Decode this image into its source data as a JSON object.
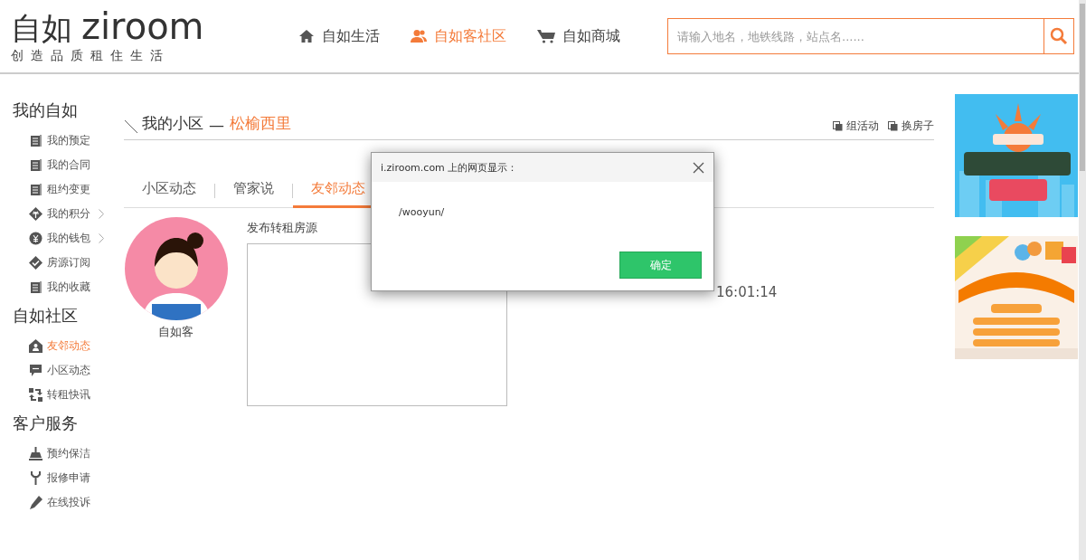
{
  "logo": {
    "name": "自如",
    "brand": "ziroom",
    "tagline": "创造品质租住生活"
  },
  "nav": [
    {
      "label": "自如生活",
      "kind": "home",
      "selected": false
    },
    {
      "label": "自如客社区",
      "kind": "people",
      "selected": true
    },
    {
      "label": "自如商城",
      "kind": "cart",
      "selected": false
    }
  ],
  "search": {
    "placeholder": "请输入地名，地铁线路，站点名......"
  },
  "sidebar": [
    {
      "heading": "我的自如",
      "items": [
        {
          "label": "我的预定",
          "kind": "document",
          "selected": false,
          "expandable": false
        },
        {
          "label": "我的合同",
          "kind": "document",
          "selected": false,
          "expandable": false
        },
        {
          "label": "租约变更",
          "kind": "document",
          "selected": false,
          "expandable": false
        },
        {
          "label": "我的积分",
          "kind": "gift",
          "selected": false,
          "expandable": true
        },
        {
          "label": "我的钱包",
          "kind": "coin",
          "selected": false,
          "expandable": true
        },
        {
          "label": "房源订阅",
          "kind": "check",
          "selected": false,
          "expandable": false
        },
        {
          "label": "我的收藏",
          "kind": "document",
          "selected": false,
          "expandable": false
        }
      ]
    },
    {
      "heading": "自如社区",
      "items": [
        {
          "label": "友邻动态",
          "kind": "house-person",
          "selected": true,
          "expandable": false
        },
        {
          "label": "小区动态",
          "kind": "chat",
          "selected": false,
          "expandable": false
        },
        {
          "label": "转租快讯",
          "kind": "swap",
          "selected": false,
          "expandable": false
        }
      ]
    },
    {
      "heading": "客户服务",
      "items": [
        {
          "label": "预约保洁",
          "kind": "broom",
          "selected": false,
          "expandable": false
        },
        {
          "label": "报修申请",
          "kind": "wrench",
          "selected": false,
          "expandable": false
        },
        {
          "label": "在线投诉",
          "kind": "pencil",
          "selected": false,
          "expandable": false
        }
      ]
    }
  ],
  "page_title": {
    "title": "我的小区",
    "separator": "—",
    "place": "松榆西里"
  },
  "actions": [
    "组活动",
    "换房子"
  ],
  "tabs": [
    {
      "label": "小区动态",
      "selected": false
    },
    {
      "label": "管家说",
      "selected": false
    },
    {
      "label": "友邻动态",
      "selected": true
    }
  ],
  "profile": {
    "name": "自如客"
  },
  "post": {
    "label": "发布转租房源"
  },
  "move_in": "16:01:14",
  "banners": [
    {
      "kind": "picture"
    },
    {
      "kind": "picture"
    }
  ],
  "dialog": {
    "title": "i.ziroom.com 上的网页显示：",
    "message": "/wooyun/",
    "button": "确定"
  }
}
